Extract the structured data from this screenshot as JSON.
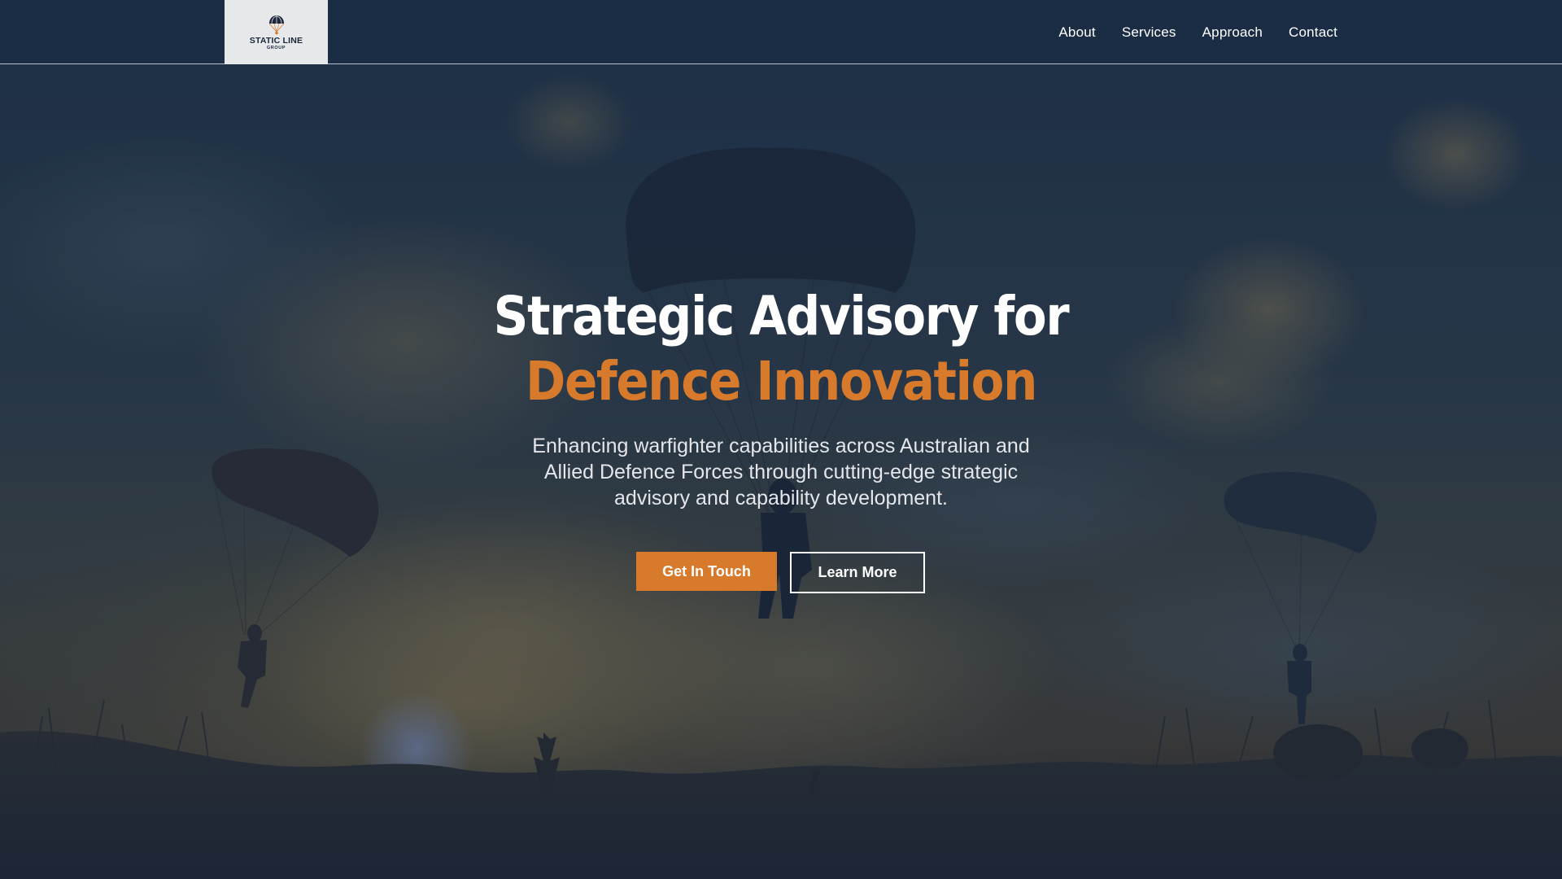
{
  "logo": {
    "name": "STATIC LINE",
    "sub": "GROUP"
  },
  "nav": {
    "items": [
      "About",
      "Services",
      "Approach",
      "Contact"
    ]
  },
  "hero": {
    "title_line1": "Strategic Advisory for",
    "title_line2": "Defence Innovation",
    "subtitle": "Enhancing warfighter capabilities across Australian and Allied Defence Forces through cutting-edge strategic advisory and capability development.",
    "primary_button": "Get In Touch",
    "secondary_button": "Learn More"
  },
  "colors": {
    "header_bg": "#1b2d45",
    "accent": "#d77a2b",
    "text_light": "#ffffff"
  },
  "icons": {
    "logo": "parachute-icon",
    "background": "paratroopers-sunset-image"
  }
}
